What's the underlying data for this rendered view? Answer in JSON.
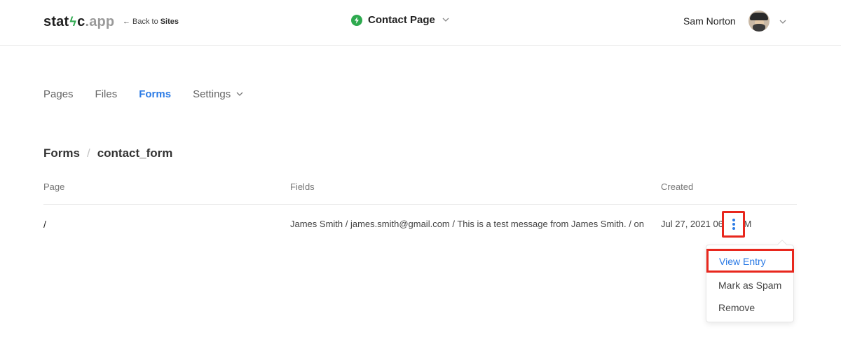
{
  "header": {
    "logo": {
      "part1": "stat",
      "bolt": "ϟ",
      "part2": "c",
      "part3": ".app"
    },
    "back_link": {
      "arrow": "←",
      "text": "Back to",
      "bold": "Sites"
    },
    "site": {
      "icon": "lightning-circle-icon",
      "name": "Contact Page",
      "chevron": "⌄"
    },
    "user": {
      "name": "Sam Norton",
      "chevron": "⌄"
    }
  },
  "tabs": [
    {
      "label": "Pages",
      "active": false
    },
    {
      "label": "Files",
      "active": false
    },
    {
      "label": "Forms",
      "active": true
    },
    {
      "label": "Settings",
      "active": false,
      "chevron": "⌄"
    }
  ],
  "breadcrumb": {
    "parent": "Forms",
    "separator": "/",
    "current": "contact_form"
  },
  "table": {
    "columns": {
      "page": "Page",
      "fields": "Fields",
      "created": "Created"
    },
    "rows": [
      {
        "page": "/",
        "fields": "James Smith / james.smith@gmail.com / This is a test message from James Smith. / on",
        "created": "Jul 27, 2021 06:41 AM"
      }
    ]
  },
  "row_menu": {
    "items": {
      "view": "View Entry",
      "spam": "Mark as Spam",
      "remove": "Remove"
    }
  },
  "colors": {
    "accent": "#2c7be5",
    "brand_green": "#2eaa4f",
    "highlight": "#e8271d"
  }
}
